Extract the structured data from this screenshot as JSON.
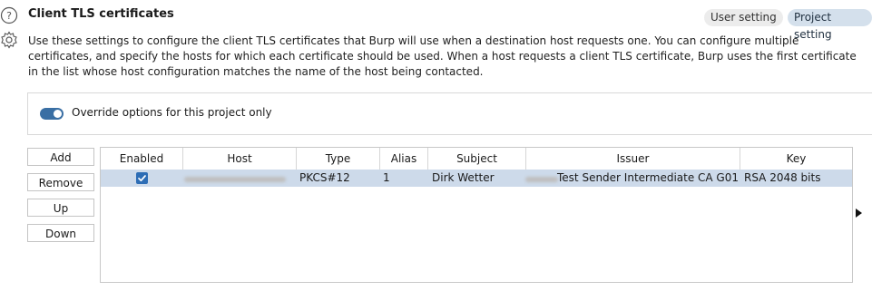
{
  "header": {
    "title": "Client TLS certificates",
    "user_setting_label": "User setting",
    "project_setting_label": "Project setting"
  },
  "description": "Use these settings to configure the client TLS certificates that Burp will use when a destination host requests one. You can configure multiple certificates, and specify the hosts for which each certificate should be used. When a host requests a client TLS certificate, Burp uses the first certificate in the list whose host configuration matches the name of the host being contacted.",
  "override": {
    "label": "Override options for this project only",
    "enabled": true
  },
  "buttons": {
    "add": "Add",
    "remove": "Remove",
    "up": "Up",
    "down": "Down"
  },
  "table": {
    "columns": [
      "Enabled",
      "Host",
      "Type",
      "Alias",
      "Subject",
      "Issuer",
      "Key"
    ],
    "rows": [
      {
        "enabled": true,
        "type": "PKCS#12",
        "alias": "1",
        "subject": "Dirk Wetter",
        "issuer": "Test Sender Intermediate CA G01",
        "key": "RSA 2048 bits"
      }
    ]
  },
  "colors": {
    "accent": "#3a6fa4",
    "selected_row": "#cddaea",
    "project_pill": "#d4e0ec"
  },
  "icons": [
    "help-icon",
    "gear-icon",
    "check-icon",
    "scroll-right-arrow-icon"
  ]
}
